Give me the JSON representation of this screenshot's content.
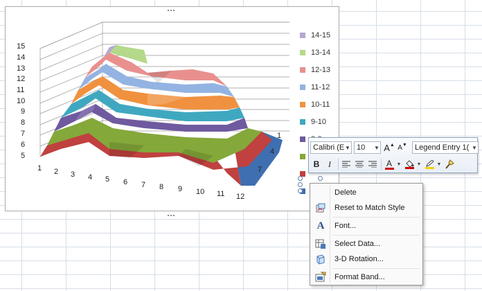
{
  "chart": {
    "type": "surface",
    "y_axis_ticks": [
      "15",
      "14",
      "13",
      "12",
      "11",
      "10",
      "9",
      "8",
      "7",
      "6",
      "5"
    ],
    "x_axis_ticks": [
      "1",
      "2",
      "3",
      "4",
      "5",
      "6",
      "7",
      "8",
      "9",
      "10",
      "11",
      "12"
    ],
    "depth_axis_ticks": [
      "1",
      "4",
      "7"
    ],
    "legend": [
      {
        "label": "14-15",
        "color": "#b5a6d3"
      },
      {
        "label": "13-14",
        "color": "#b4d98a"
      },
      {
        "label": "12-13",
        "color": "#e9908f"
      },
      {
        "label": "11-12",
        "color": "#93b3e2"
      },
      {
        "label": "10-11",
        "color": "#f0913f"
      },
      {
        "label": "9-10",
        "color": "#3fa8c0"
      },
      {
        "label": "8-9",
        "color": "#6f5aa0"
      },
      {
        "label": "",
        "color": "#84a83a"
      },
      {
        "label": "",
        "color": "#c0413f"
      },
      {
        "label": "",
        "color": "#3f6fb0"
      }
    ]
  },
  "mini_toolbar": {
    "font_name": "Calibri (E",
    "font_size": "10",
    "element_select": "Legend Entry 1(",
    "grow_font_glyph": "A",
    "shrink_font_glyph": "A",
    "bold_glyph": "B",
    "italic_glyph": "I",
    "font_color_glyph": "A",
    "font_color": "#cc0000",
    "fill_color": "#cc0000",
    "line_color": "#f2d200"
  },
  "context_menu": {
    "items": [
      {
        "label": "Delete",
        "icon": "none"
      },
      {
        "label": "Reset to Match Style",
        "icon": "reset-style-icon"
      },
      {
        "label": "Font...",
        "icon": "font-icon"
      },
      {
        "label": "Select Data...",
        "icon": "select-data-icon"
      },
      {
        "label": "3-D Rotation...",
        "icon": "rotation-3d-icon"
      },
      {
        "label": "Format Band...",
        "icon": "format-band-icon"
      }
    ]
  }
}
